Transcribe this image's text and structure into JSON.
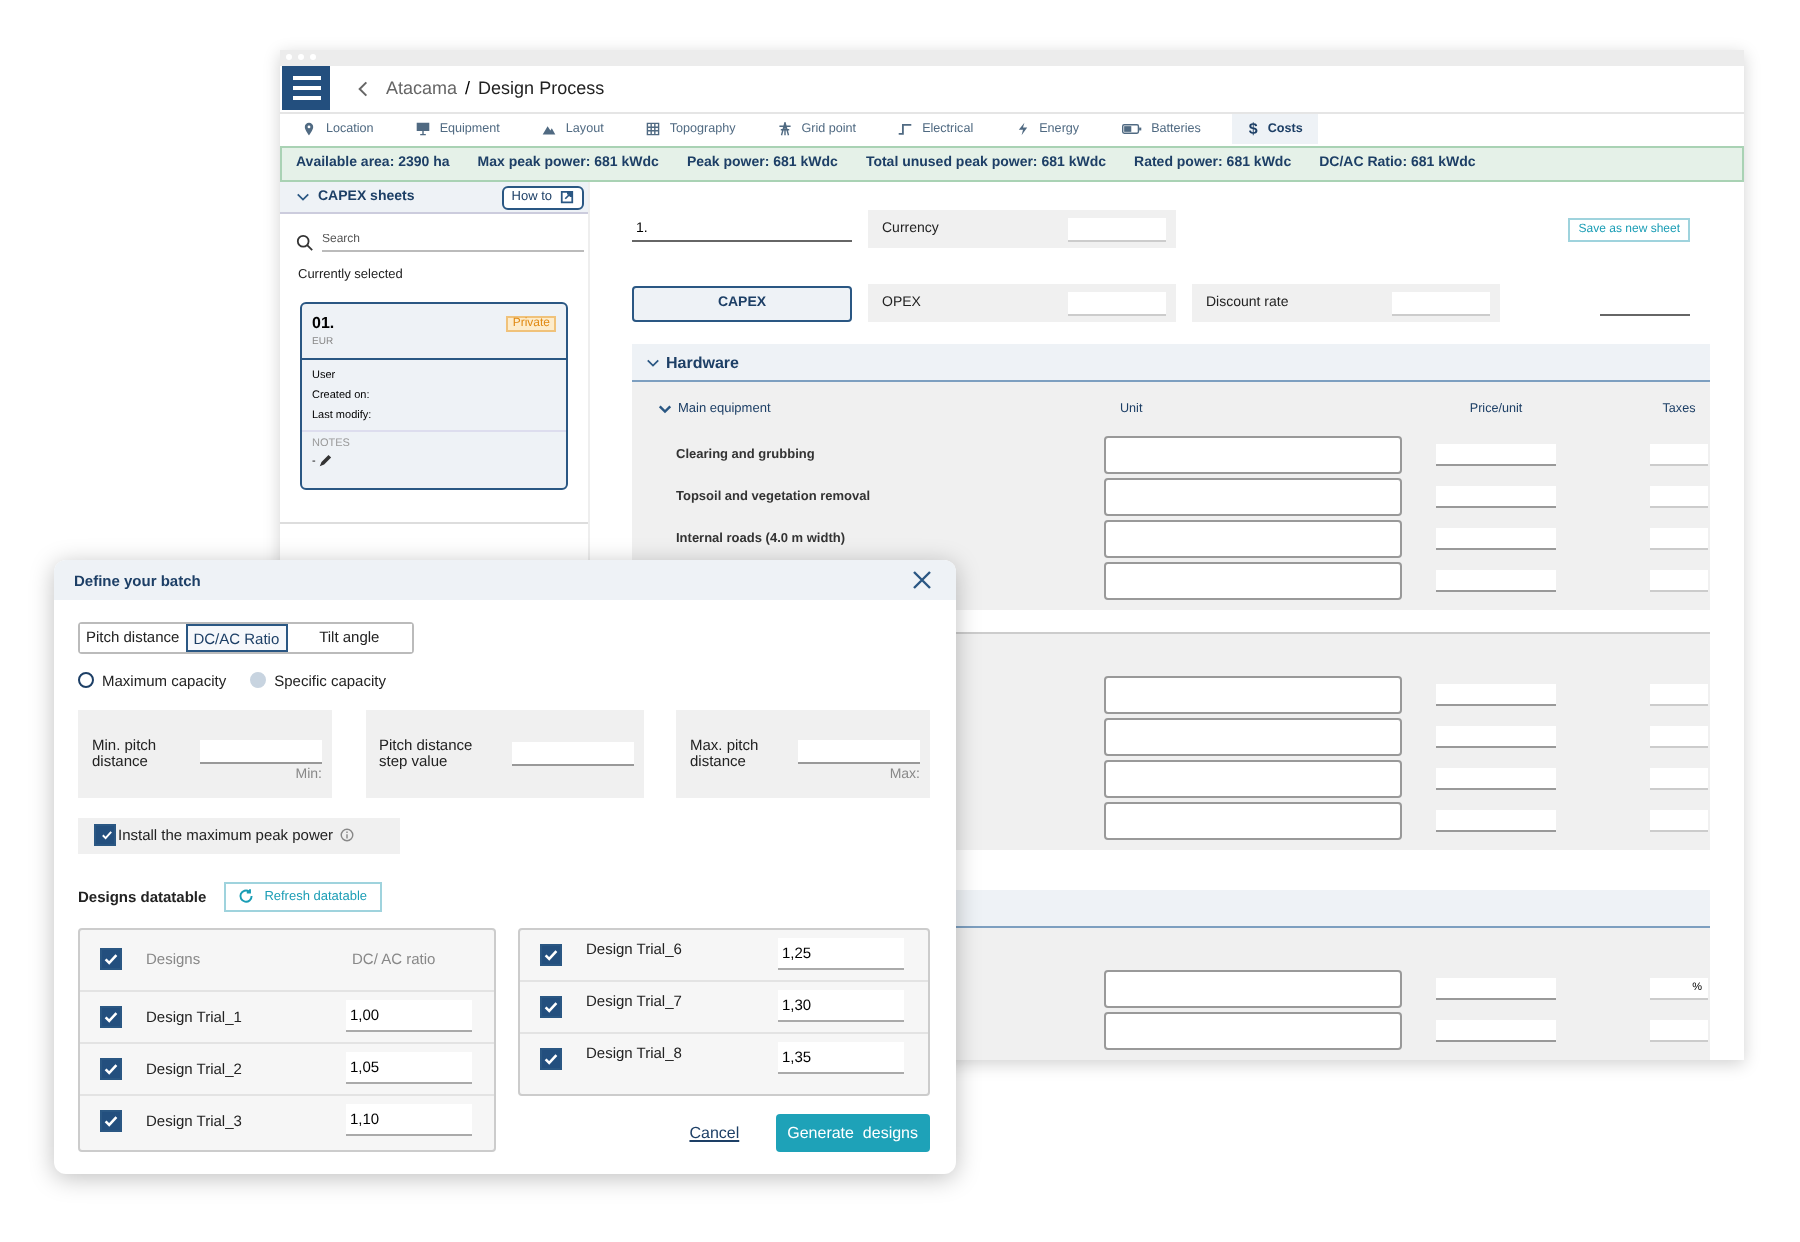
{
  "header": {
    "breadcrumb_parent": "Atacama",
    "breadcrumb_separator": "/",
    "breadcrumb_current": "Design Process"
  },
  "tabs": [
    {
      "label": "Location",
      "selected": false
    },
    {
      "label": "Equipment",
      "selected": false
    },
    {
      "label": "Layout",
      "selected": false
    },
    {
      "label": "Topography",
      "selected": false
    },
    {
      "label": "Grid point",
      "selected": false
    },
    {
      "label": "Electrical",
      "selected": false
    },
    {
      "label": "Energy",
      "selected": false
    },
    {
      "label": "Batteries",
      "selected": false
    },
    {
      "label": "Costs",
      "selected": true,
      "glyph": "$"
    }
  ],
  "status_bar": [
    "Available area: 2390 ha",
    "Max peak power: 681 kWdc",
    "Peak power: 681 kWdc",
    "Total unused peak power: 681 kWdc",
    "Rated power: 681 kWdc",
    "DC/AC Ratio: 681 kWdc"
  ],
  "sidebar": {
    "title": "CAPEX sheets",
    "expanded": true,
    "how_to_button": "How to",
    "search_placeholder": "Search",
    "currently_selected": "Currently selected",
    "card": {
      "title": "01.",
      "currency": "EUR",
      "badge": "Private",
      "fields": [
        "User",
        "Created on:",
        "Last modify:"
      ],
      "notes_label": "NOTES",
      "notes_value": "-"
    }
  },
  "main": {
    "sheet_name": "1.",
    "currency_label": "Currency",
    "save_button": "Save as new sheet",
    "capex_button": "CAPEX",
    "opex_label": "OPEX",
    "discount_label": "Discount rate",
    "sections": [
      {
        "kind": "titled",
        "title": "Hardware",
        "expanded": true,
        "group_title": "Main equipment",
        "group_expanded": true,
        "columns": [
          "Unit",
          "Price/unit",
          "Taxes"
        ],
        "rows": [
          {
            "kind": "labeled",
            "label": "Clearing and grubbing"
          },
          {
            "kind": "labeled",
            "label": "Topsoil and vegetation removal"
          },
          {
            "kind": "labeled",
            "label": "Internal roads (4.0 m width)"
          },
          {
            "kind": "blank"
          }
        ]
      },
      {
        "kind": "plain",
        "rows": [
          {
            "kind": "blank"
          },
          {
            "kind": "blank"
          },
          {
            "kind": "blank"
          },
          {
            "kind": "blank"
          }
        ]
      },
      {
        "kind": "banner",
        "rows": [
          {
            "kind": "blank",
            "taxes": "%"
          },
          {
            "kind": "blank"
          }
        ]
      }
    ]
  },
  "dialog": {
    "title": "Define your batch",
    "segments": [
      {
        "label": "Pitch distance",
        "selected": false
      },
      {
        "label": "DC/AC Ratio",
        "selected": true
      },
      {
        "label": "Tilt angle",
        "selected": false
      }
    ],
    "radios": [
      {
        "label": "Maximum capacity",
        "selected": true
      },
      {
        "label": "Specific capacity",
        "selected": false
      }
    ],
    "range": [
      {
        "label": "Min. pitch distance",
        "hint": "Min:"
      },
      {
        "label": "Pitch distance step value"
      },
      {
        "label": "Max. pitch distance",
        "hint": "Max:"
      }
    ],
    "install_max": {
      "label": "Install the maximum peak power",
      "checked": true
    },
    "datatable_title": "Designs datatable",
    "refresh_button": "Refresh datatable",
    "table_header": {
      "checked": true,
      "columns": [
        "Designs",
        "DC/ AC ratio"
      ]
    },
    "left_rows": [
      {
        "name": "Design Trial_1",
        "ratio": "1,00",
        "checked": true
      },
      {
        "name": "Design Trial_2",
        "ratio": "1,05",
        "checked": true
      },
      {
        "name": "Design Trial_3",
        "ratio": "1,10",
        "checked": true
      }
    ],
    "right_rows": [
      {
        "name": "Design Trial_6",
        "ratio": "1,25",
        "checked": true
      },
      {
        "name": "Design Trial_7",
        "ratio": "1,30",
        "checked": true
      },
      {
        "name": "Design Trial_8",
        "ratio": "1,35",
        "checked": true
      }
    ],
    "cancel": "Cancel",
    "generate": "Generate  designs"
  }
}
